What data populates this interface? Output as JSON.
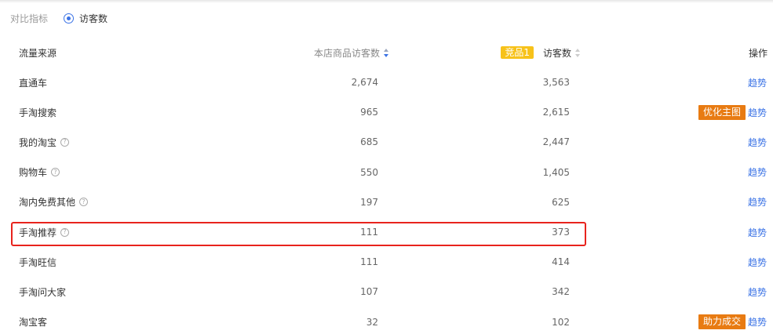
{
  "compare": {
    "label": "对比指标",
    "option": "访客数"
  },
  "table": {
    "headers": {
      "source": "流量来源",
      "self_visitors": "本店商品访客数",
      "competitor_badge": "竞品1",
      "competitor_visitors": "访客数",
      "action": "操作"
    },
    "rows": [
      {
        "source": "直通车",
        "self": "2,674",
        "competitor": "3,563",
        "help": false,
        "tag": "",
        "trend": "趋势"
      },
      {
        "source": "手淘搜索",
        "self": "965",
        "competitor": "2,615",
        "help": false,
        "tag": "优化主图",
        "trend": "趋势"
      },
      {
        "source": "我的淘宝",
        "self": "685",
        "competitor": "2,447",
        "help": true,
        "tag": "",
        "trend": "趋势"
      },
      {
        "source": "购物车",
        "self": "550",
        "competitor": "1,405",
        "help": true,
        "tag": "",
        "trend": "趋势"
      },
      {
        "source": "淘内免费其他",
        "self": "197",
        "competitor": "625",
        "help": true,
        "tag": "",
        "trend": "趋势"
      },
      {
        "source": "手淘推荐",
        "self": "111",
        "competitor": "373",
        "help": true,
        "tag": "",
        "trend": "趋势"
      },
      {
        "source": "手淘旺信",
        "self": "111",
        "competitor": "414",
        "help": false,
        "tag": "",
        "trend": "趋势"
      },
      {
        "source": "手淘问大家",
        "self": "107",
        "competitor": "342",
        "help": false,
        "tag": "",
        "trend": "趋势"
      },
      {
        "source": "淘宝客",
        "self": "32",
        "competitor": "102",
        "help": false,
        "tag": "助力成交",
        "trend": "趋势"
      }
    ]
  },
  "colors": {
    "accent_blue": "#3b73e6",
    "badge_yellow": "#f7c21a",
    "tag_orange": "#e87b12",
    "highlight_red": "#e8231d"
  },
  "icons": {
    "help": "question-circle-icon",
    "sort": "sort-icon",
    "radio": "radio-selected-icon"
  },
  "help_glyph": "?"
}
